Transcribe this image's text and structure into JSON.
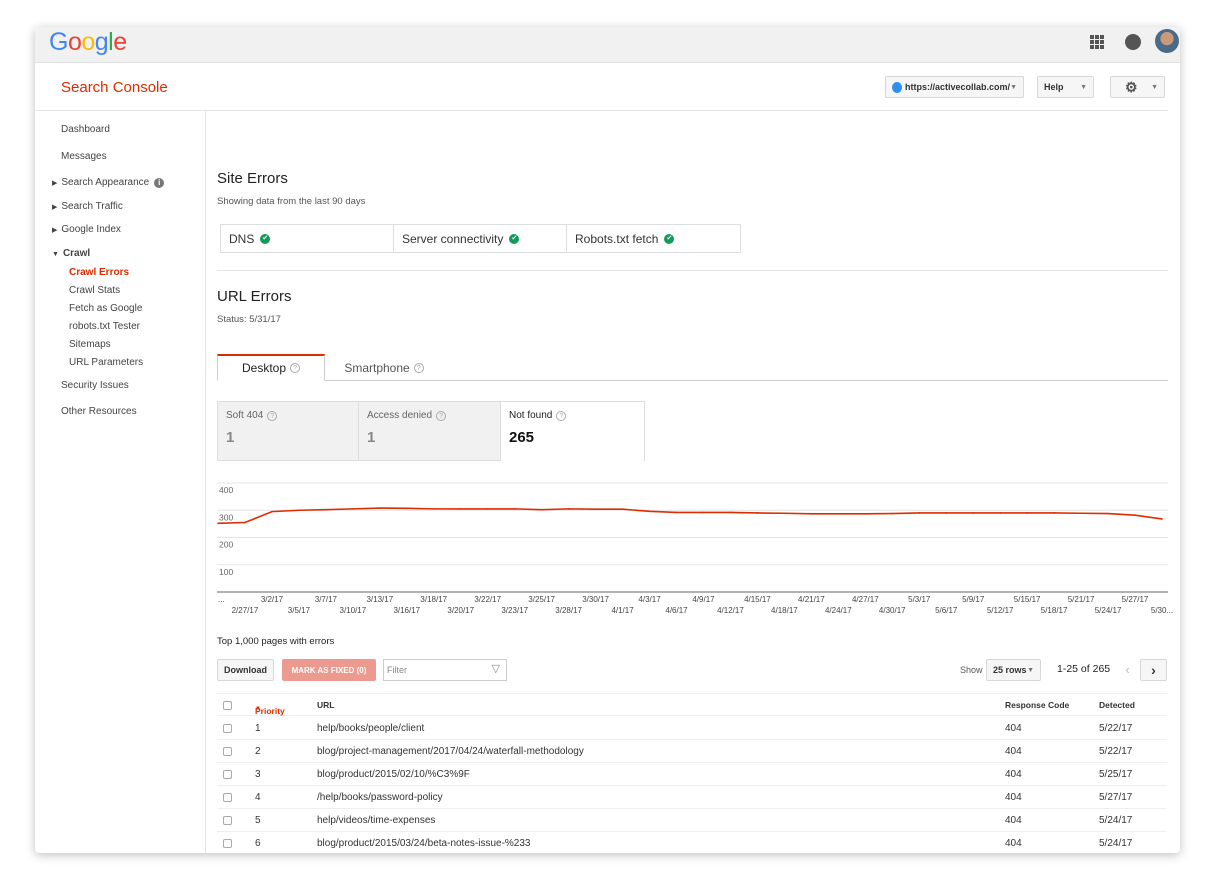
{
  "header": {
    "logo": "Google",
    "product": "Search Console",
    "site": "https://activecollab.com/",
    "help": "Help"
  },
  "sidebar": {
    "items": [
      {
        "label": "Dashboard"
      },
      {
        "label": "Messages"
      },
      {
        "label": "Search Appearance"
      },
      {
        "label": "Search Traffic"
      },
      {
        "label": "Google Index"
      },
      {
        "label": "Crawl"
      },
      {
        "label": "Crawl Errors"
      },
      {
        "label": "Crawl Stats"
      },
      {
        "label": "Fetch as Google"
      },
      {
        "label": "robots.txt Tester"
      },
      {
        "label": "Sitemaps"
      },
      {
        "label": "URL Parameters"
      },
      {
        "label": "Security Issues"
      },
      {
        "label": "Other Resources"
      }
    ]
  },
  "site_errors": {
    "title": "Site Errors",
    "subtitle": "Showing data from the last 90 days",
    "items": [
      "DNS",
      "Server connectivity",
      "Robots.txt fetch"
    ]
  },
  "url_errors": {
    "title": "URL Errors",
    "status": "Status: 5/31/17",
    "tabs": [
      "Desktop",
      "Smartphone"
    ],
    "cards": [
      {
        "label": "Soft 404",
        "value": "1"
      },
      {
        "label": "Access denied",
        "value": "1"
      },
      {
        "label": "Not found",
        "value": "265"
      }
    ]
  },
  "chart_data": {
    "type": "line",
    "color": "#dd2c00",
    "ylim": [
      0,
      400
    ],
    "yticks": [
      "400",
      "300",
      "200",
      "100"
    ],
    "grid": true,
    "x": [
      "...",
      "2/27/17",
      "3/2/17",
      "3/5/17",
      "3/7/17",
      "3/10/17",
      "3/13/17",
      "3/16/17",
      "3/18/17",
      "3/20/17",
      "3/22/17",
      "3/23/17",
      "3/25/17",
      "3/28/17",
      "3/30/17",
      "4/1/17",
      "4/3/17",
      "4/6/17",
      "4/9/17",
      "4/12/17",
      "4/15/17",
      "4/18/17",
      "4/21/17",
      "4/24/17",
      "4/27/17",
      "4/30/17",
      "5/3/17",
      "5/6/17",
      "5/9/17",
      "5/12/17",
      "5/15/17",
      "5/18/17",
      "5/21/17",
      "5/24/17",
      "5/27/17",
      "5/30..."
    ],
    "values": [
      252,
      255,
      295,
      300,
      302,
      305,
      308,
      307,
      305,
      305,
      305,
      305,
      302,
      305,
      304,
      304,
      296,
      292,
      292,
      292,
      290,
      289,
      287,
      287,
      287,
      288,
      290,
      290,
      290,
      290,
      290,
      290,
      289,
      288,
      282,
      268
    ]
  },
  "table": {
    "caption": "Top 1,000 pages with errors",
    "download": "Download",
    "mark_fixed": "MARK AS FIXED (0)",
    "filter_placeholder": "Filter",
    "show": "Show",
    "rows_select": "25 rows",
    "pagination": "1-25 of 265",
    "headers": {
      "priority": "Priority",
      "url": "URL",
      "code": "Response Code",
      "detected": "Detected"
    },
    "rows": [
      {
        "priority": "1",
        "url": "help/books/people/client",
        "code": "404",
        "detected": "5/22/17"
      },
      {
        "priority": "2",
        "url": "blog/project-management/2017/04/24/waterfall-methodology",
        "code": "404",
        "detected": "5/22/17"
      },
      {
        "priority": "3",
        "url": "blog/product/2015/02/10/%C3%9F",
        "code": "404",
        "detected": "5/25/17"
      },
      {
        "priority": "4",
        "url": "/help/books/password-policy",
        "code": "404",
        "detected": "5/27/17"
      },
      {
        "priority": "5",
        "url": "help/videos/time-expenses",
        "code": "404",
        "detected": "5/24/17"
      },
      {
        "priority": "6",
        "url": "blog/product/2015/03/24/beta-notes-issue-%233",
        "code": "404",
        "detected": "5/24/17"
      }
    ]
  }
}
